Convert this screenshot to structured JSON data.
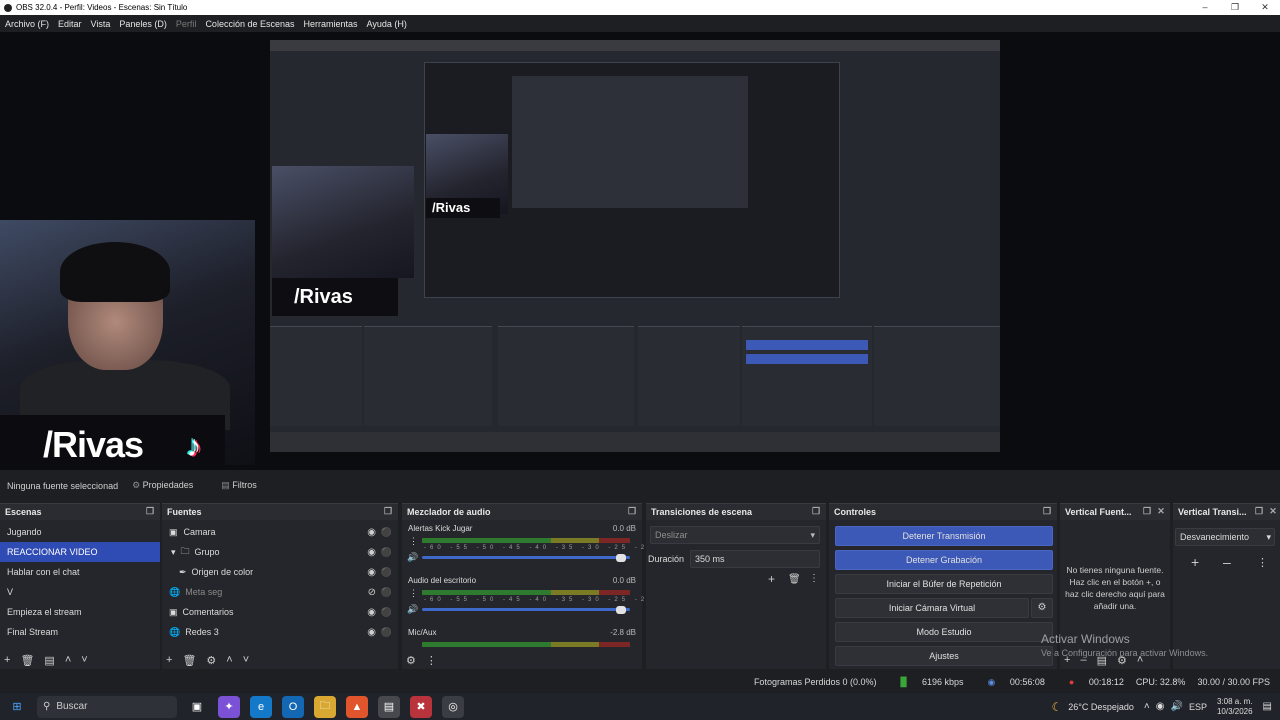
{
  "window": {
    "title": "OBS 32.0.4 - Perfil: Videos - Escenas: Sin Título"
  },
  "menu": {
    "items": [
      "Archivo (F)",
      "Editar",
      "Vista",
      "Paneles (D)",
      "Perfil",
      "Colección de Escenas",
      "Herramientas",
      "Ayuda (H)"
    ]
  },
  "preview": {
    "overlay_text": "/Rivas"
  },
  "source_bar": {
    "selection": "Ninguna fuente seleccionad",
    "properties": "Propiedades",
    "filters": "Filtros"
  },
  "scenes": {
    "title": "Escenas",
    "items": [
      "Jugando",
      "REACCIONAR VIDEO",
      "Hablar con el chat",
      "V",
      "Empieza el stream",
      "Final Stream"
    ],
    "selected_index": 1
  },
  "sources": {
    "title": "Fuentes",
    "items": [
      "Camara",
      "Grupo",
      "Origen de color",
      "Meta seg",
      "Comentarios",
      "Redes 3"
    ]
  },
  "mixer": {
    "title": "Mezclador de audio",
    "channels": [
      {
        "name": "Alertas Kick Jugar",
        "db": "0.0 dB",
        "level": 0.65
      },
      {
        "name": "Audio del escritorio",
        "db": "0.0 dB",
        "level": 0.8
      },
      {
        "name": "Mic/Aux",
        "db": "-2.8 dB",
        "level": 0.3
      }
    ],
    "scale": "-60 -55 -50 -45 -40 -35 -30 -25 -20 -15 -10 -5 0"
  },
  "transitions": {
    "title": "Transiciones de escena",
    "selected": "Deslizar",
    "duration_label": "Duración",
    "duration_value": "350 ms"
  },
  "controls": {
    "title": "Controles",
    "buttons": [
      "Detener Transmisión",
      "Detener Grabación",
      "Iniciar el Búfer de Repetición",
      "Iniciar Cámara Virtual",
      "Modo Estudio",
      "Ajustes"
    ]
  },
  "vertical_sources": {
    "title": "Vertical Fuent...",
    "empty": "No tienes ninguna fuente. Haz clic en el botón +, o haz clic derecho aquí para añadir una."
  },
  "vertical_transitions": {
    "title": "Vertical Transi...",
    "selected": "Desvanecimiento"
  },
  "status": {
    "dropped": "Fotogramas Perdidos 0 (0.0%)",
    "bitrate": "6196 kbps",
    "stream_time": "00:56:08",
    "rec_time": "00:18:12",
    "cpu": "CPU: 32.8%",
    "fps": "30.00 / 30.00 FPS"
  },
  "watermark": {
    "line1": "Activar Windows",
    "line2": "Ve a Configuración para activar Windows."
  },
  "taskbar": {
    "search": "Buscar",
    "weather": "26°C  Despejado",
    "lang": "ESP",
    "time": "3:08 a. m.",
    "date": "10/3/2026"
  }
}
